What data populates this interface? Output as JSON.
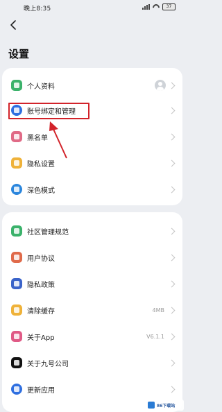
{
  "status_bar": {
    "time": "晚上8:35",
    "battery": "37"
  },
  "page_title": "设置",
  "group1": [
    {
      "label": "个人资料",
      "icon": "profile-icon",
      "color": "#3bb26b",
      "trailing": "avatar"
    },
    {
      "label": "账号绑定和管理",
      "icon": "link-icon",
      "color": "#2f6fe0"
    },
    {
      "label": "黑名单",
      "icon": "blacklist-icon",
      "color": "#e06a86"
    },
    {
      "label": "隐私设置",
      "icon": "lock-icon",
      "color": "#efb23a"
    },
    {
      "label": "深色模式",
      "icon": "dark-mode-icon",
      "color": "#2b86dd"
    }
  ],
  "group2": [
    {
      "label": "社区管理规范",
      "icon": "community-icon",
      "color": "#3bb26b"
    },
    {
      "label": "用户协议",
      "icon": "agreement-icon",
      "color": "#e06a4a"
    },
    {
      "label": "隐私政策",
      "icon": "policy-icon",
      "color": "#3a63c9"
    },
    {
      "label": "清除缓存",
      "icon": "clear-cache-icon",
      "color": "#efb23a",
      "value": "4MB"
    },
    {
      "label": "关于App",
      "icon": "about-app-icon",
      "color": "#e05a86",
      "value": "V6.1.1"
    },
    {
      "label": "关于九号公司",
      "icon": "ninebot-icon",
      "color": "#111111"
    },
    {
      "label": "更新应用",
      "icon": "update-icon",
      "color": "#2f6fe0"
    }
  ],
  "watermark": {
    "text": "86下载站"
  },
  "annotation_color": "#d2232a"
}
